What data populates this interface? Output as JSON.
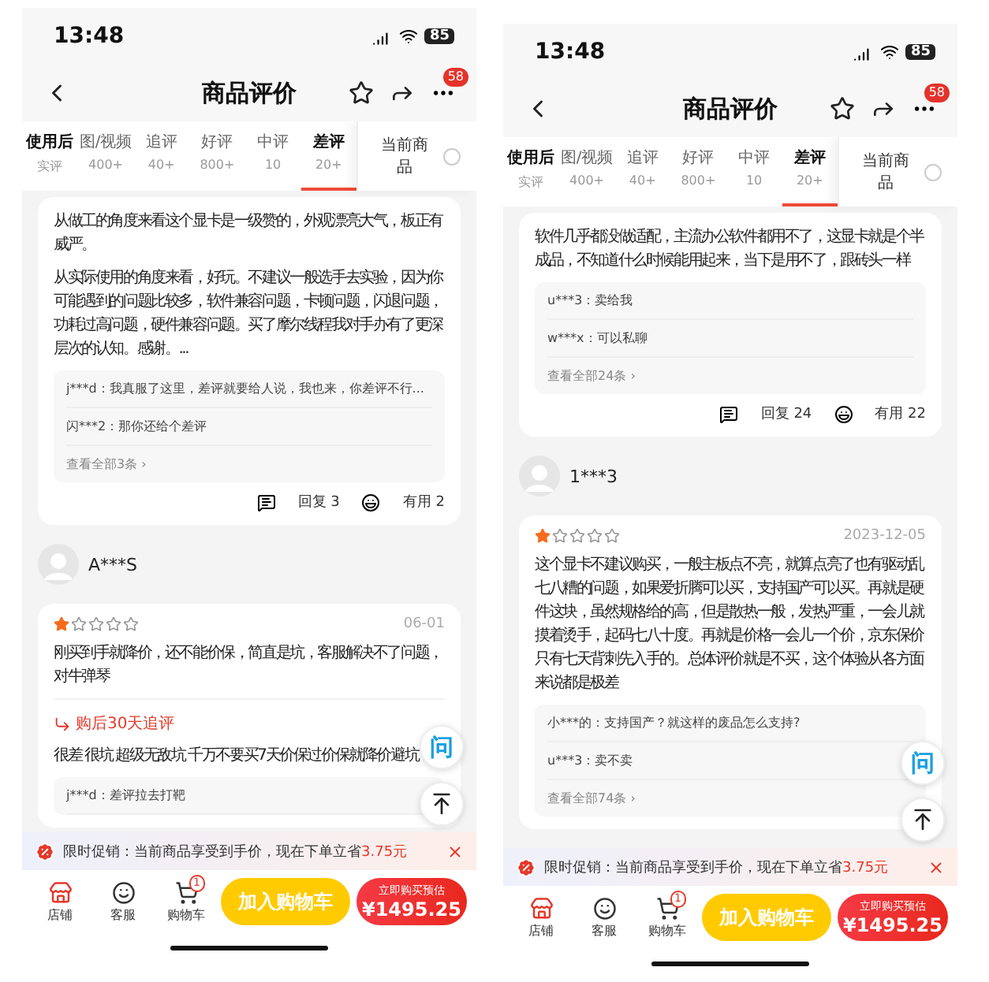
{
  "phones": [
    {
      "time": "13:48",
      "battery": "85",
      "title": "商品评价",
      "more_badge": "58",
      "tabs": [
        {
          "label": "使用后",
          "sub": "实评",
          "selected": false
        },
        {
          "label": "图/视频",
          "sub": "400+",
          "selected": false
        },
        {
          "label": "追评",
          "sub": "40+",
          "selected": false
        },
        {
          "label": "好评",
          "sub": "800+",
          "selected": false
        },
        {
          "label": "中评",
          "sub": "10",
          "selected": false
        },
        {
          "label": "差评",
          "sub": "20+",
          "selected": true
        }
      ],
      "filter": {
        "label": "当前商品",
        "checked": false
      },
      "feed": [
        {
          "kind": "card",
          "paragraphs": [
            "从做工的角度来看这个显卡是一级赞的，外观漂亮大气，板正有威严。",
            "从实际使用的角度来看，好玩。不建议一般选手去实验，因为你可能遇到的问题比较多，软件兼容问题，卡顿问题，闪退问题，功耗过高问题，硬件兼容问题。买了摩尔线程我对手办有了更深层次的认知。感谢。..."
          ],
          "replies": [
            "j***d：我真服了这里，差评就要给人说，我也来，你差评不行...",
            "闪***2：那你还给个差评"
          ],
          "more": "查看全部3条 ›",
          "reply_count": "回复 3",
          "useful": "有用 2"
        },
        {
          "kind": "user",
          "name": "A***S"
        },
        {
          "kind": "card",
          "stars": 1,
          "date": "06-01",
          "paragraphs": [
            "刚买到手就降价，还不能价保，简直是坑，客服解决不了问题，对牛弹琴"
          ],
          "followup_label": "购后30天追评",
          "followup": "很差 很坑 超级无敌坑 千万不要买7天价保过价保就降价避坑",
          "replies": [
            "j***d：差评拉去打靶"
          ]
        }
      ],
      "ask": "问",
      "promo": {
        "text": "限时促销：当前商品享受到手价，现在下单立省",
        "amount": "3.75元"
      },
      "bar": {
        "shop": "店铺",
        "service": "客服",
        "cart": "购物车",
        "cart_badge": "1",
        "add": "加入购物车",
        "buy_top": "立即购买预估",
        "buy_price": "¥1495.25"
      }
    },
    {
      "time": "13:48",
      "battery": "85",
      "title": "商品评价",
      "more_badge": "58",
      "tabs": [
        {
          "label": "使用后",
          "sub": "实评",
          "selected": false
        },
        {
          "label": "图/视频",
          "sub": "400+",
          "selected": false
        },
        {
          "label": "追评",
          "sub": "40+",
          "selected": false
        },
        {
          "label": "好评",
          "sub": "800+",
          "selected": false
        },
        {
          "label": "中评",
          "sub": "10",
          "selected": false
        },
        {
          "label": "差评",
          "sub": "20+",
          "selected": true
        }
      ],
      "filter": {
        "label": "当前商品",
        "checked": false
      },
      "feed": [
        {
          "kind": "card",
          "paragraphs": [
            "软件几乎都没做适配，主流办公软件都用不了，这显卡就是个半成品，不知道什么时候能用起来，当下是用不了，跟砖头一样"
          ],
          "replies": [
            "u***3：卖给我",
            "w***x：可以私聊"
          ],
          "more": "查看全部24条 ›",
          "reply_count": "回复 24",
          "useful": "有用 22"
        },
        {
          "kind": "user",
          "name": "1***3"
        },
        {
          "kind": "card",
          "stars": 1,
          "date": "2023-12-05",
          "paragraphs": [
            "这个显卡不建议购买，一般主板点不亮，就算点亮了也有驱动乱七八糟的问题，如果爱折腾可以买，支持国产可以买。再就是硬件这块，虽然规格给的高，但是散热一般，发热严重，一会儿就摸着烫手，起码七八十度。再就是价格一会儿一个价，京东保价只有七天背刺先入手的。总体评价就是不买，这个体验从各方面来说都是极差"
          ],
          "replies": [
            "小***的：支持国产？就这样的废品怎么支持?",
            "u***3：卖不卖"
          ],
          "more": "查看全部74条 ›"
        }
      ],
      "ask": "问",
      "promo": {
        "text": "限时促销：当前商品享受到手价，现在下单立省",
        "amount": "3.75元"
      },
      "bar": {
        "shop": "店铺",
        "service": "客服",
        "cart": "购物车",
        "cart_badge": "1",
        "add": "加入购物车",
        "buy_top": "立即购买预估",
        "buy_price": "¥1495.25"
      }
    }
  ]
}
